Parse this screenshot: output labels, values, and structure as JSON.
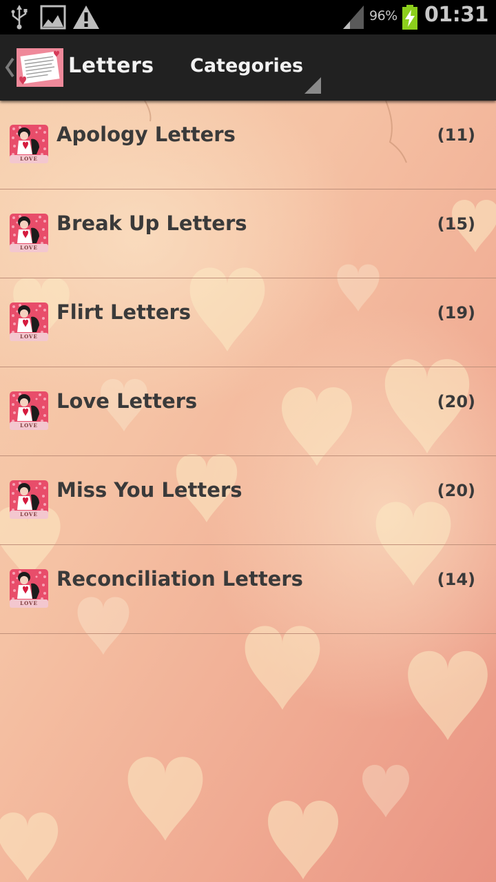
{
  "status_bar": {
    "battery_percent": "96%",
    "clock": "01:31",
    "icons": [
      "usb-icon",
      "image-icon",
      "warning-icon",
      "signal-icon",
      "battery-charging-icon"
    ]
  },
  "action_bar": {
    "title": "Letters",
    "spinner_label": "Categories",
    "icons": [
      "up-caret-icon",
      "app-logo-icon",
      "spinner-arrow-icon"
    ]
  },
  "categories": [
    {
      "label": "Apology Letters",
      "count": "(11)",
      "icon": "love-card-icon"
    },
    {
      "label": "Break Up Letters",
      "count": "(15)",
      "icon": "love-card-icon"
    },
    {
      "label": "Flirt Letters",
      "count": "(19)",
      "icon": "love-card-icon"
    },
    {
      "label": "Love Letters",
      "count": "(20)",
      "icon": "love-card-icon"
    },
    {
      "label": "Miss You Letters",
      "count": "(20)",
      "icon": "love-card-icon"
    },
    {
      "label": "Reconciliation Letters",
      "count": "(14)",
      "icon": "love-card-icon"
    }
  ],
  "icon_badge_text": "LOVE",
  "colors": {
    "status_bar_bg": "#000000",
    "action_bar_bg": "#212121",
    "text_light": "#f2f2f2",
    "text_dark": "#3a3a3a",
    "divider": "#c0907a",
    "background_pink": "#f2b9a4",
    "background_peach": "#f7d6b8",
    "battery_green": "#8ccf1c"
  }
}
